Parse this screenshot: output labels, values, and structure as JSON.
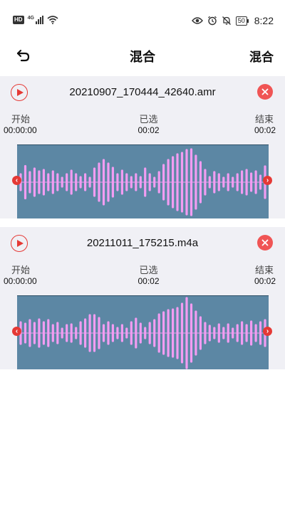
{
  "status_bar": {
    "left_badges": [
      "HD",
      "4G"
    ],
    "battery": "50",
    "time": "8:22"
  },
  "header": {
    "title": "混合",
    "action_label": "混合",
    "back_icon": "back-arrow-icon"
  },
  "labels": {
    "start": "开始",
    "selected": "已选",
    "end": "结束"
  },
  "tracks": [
    {
      "file_name": "20210907_170444_42640.amr",
      "start_time": "00:00:00",
      "selected_time": "00:02",
      "end_time": "00:02",
      "amplitudes": [
        0.22,
        0.45,
        0.28,
        0.38,
        0.3,
        0.34,
        0.22,
        0.3,
        0.22,
        0.12,
        0.22,
        0.32,
        0.22,
        0.14,
        0.22,
        0.12,
        0.38,
        0.52,
        0.62,
        0.52,
        0.4,
        0.22,
        0.32,
        0.22,
        0.14,
        0.22,
        0.14,
        0.38,
        0.22,
        0.12,
        0.28,
        0.48,
        0.62,
        0.7,
        0.78,
        0.82,
        0.9,
        0.92,
        0.74,
        0.56,
        0.34,
        0.14,
        0.28,
        0.22,
        0.12,
        0.22,
        0.12,
        0.22,
        0.3,
        0.34,
        0.24,
        0.3,
        0.18,
        0.44
      ]
    },
    {
      "file_name": "20211011_175215.m4a",
      "start_time": "00:00:00",
      "selected_time": "00:02",
      "end_time": "00:02",
      "amplitudes": [
        0.3,
        0.26,
        0.36,
        0.28,
        0.38,
        0.3,
        0.36,
        0.22,
        0.28,
        0.12,
        0.22,
        0.24,
        0.14,
        0.3,
        0.38,
        0.5,
        0.5,
        0.42,
        0.22,
        0.3,
        0.22,
        0.14,
        0.22,
        0.12,
        0.3,
        0.4,
        0.26,
        0.14,
        0.28,
        0.36,
        0.52,
        0.58,
        0.64,
        0.66,
        0.7,
        0.82,
        0.98,
        0.8,
        0.6,
        0.44,
        0.28,
        0.2,
        0.14,
        0.24,
        0.14,
        0.24,
        0.12,
        0.22,
        0.3,
        0.22,
        0.32,
        0.22,
        0.3,
        0.36
      ]
    }
  ],
  "colors": {
    "accent": "#e53935",
    "wave_background": "#5c87a4",
    "wave_bar": "#f29cf2",
    "card_background": "#f0f0f5"
  }
}
